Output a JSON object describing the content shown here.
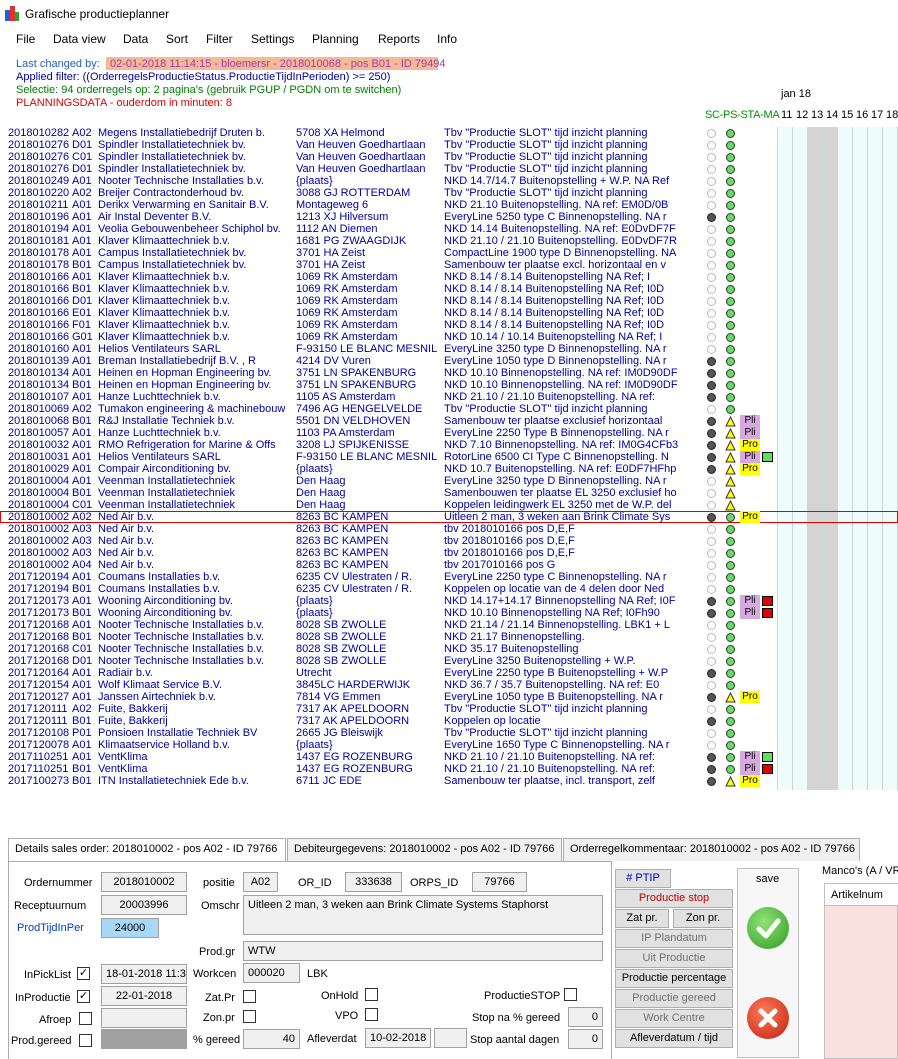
{
  "window": {
    "title": "Grafische productieplanner"
  },
  "menu": [
    "File",
    "Data view",
    "Data",
    "Sort",
    "Filter",
    "Settings",
    "Planning",
    "Reports",
    "Info"
  ],
  "header": {
    "last_changed_label": "Last changed by:",
    "last_changed_value": "02-01-2018 11:14:15 - bloemersr - 2018010068 - pos B01 - ID 79494",
    "applied_filter": "Applied filter: ((OrderregelsProductieStatus.ProductieTijdInPerioden) >= 250)",
    "selection": "Selectie: 94 orderregels op: 2 pagina's (gebruik PGUP / PGDN om te switchen)",
    "planningsdata": "PLANNINGSDATA - ouderdom in minuten: 8"
  },
  "calendar": {
    "month": "jan 18",
    "status_cols": "SC-PS-STA-MA",
    "days": [
      "11",
      "12",
      "13",
      "14",
      "15",
      "16",
      "17",
      "18"
    ]
  },
  "colors": {
    "dark_dot": "#555555",
    "empty_dot": "#ffffff",
    "green": "#5ee05e",
    "yellow": "#ffff00",
    "pli": "#d8a8e0",
    "pro": "#ffff00",
    "red": "#e00000"
  },
  "rows": [
    {
      "order": "2018010282",
      "pos": "A02",
      "name": "Megens Installatiebedrijf Druten b.",
      "city": "5708 XA Helmond",
      "desc": "Tbv \"Productie SLOT\" tijd inzicht planning",
      "s1": "empty",
      "s2": "green",
      "tag": "",
      "tag_color": "",
      "sq": ""
    },
    {
      "order": "2018010276",
      "pos": "D01",
      "name": "Spindler Installatietechniek bv.",
      "city": "Van Heuven Goedhartlaan",
      "desc": "Tbv \"Productie SLOT\" tijd inzicht planning",
      "s1": "empty",
      "s2": "green",
      "tag": "",
      "tag_color": "",
      "sq": ""
    },
    {
      "order": "2018010276",
      "pos": "C01",
      "name": "Spindler Installatietechniek bv.",
      "city": "Van Heuven Goedhartlaan",
      "desc": "Tbv \"Productie SLOT\" tijd inzicht planning",
      "s1": "empty",
      "s2": "green",
      "tag": "",
      "tag_color": "",
      "sq": ""
    },
    {
      "order": "2018010276",
      "pos": "D01",
      "name": "Spindler Installatietechniek bv.",
      "city": "Van Heuven Goedhartlaan",
      "desc": "Tbv \"Productie SLOT\" tijd inzicht planning",
      "s1": "empty",
      "s2": "green",
      "tag": "",
      "tag_color": "",
      "sq": ""
    },
    {
      "order": "2018010249",
      "pos": "A01",
      "name": "Nooter Technische Installaties b.v.",
      "city": "{plaats}",
      "desc": "NKD 14.7/14.7 Buitenopstelling + W.P. NA Ref",
      "s1": "empty",
      "s2": "green",
      "tag": "",
      "tag_color": "",
      "sq": ""
    },
    {
      "order": "2018010220",
      "pos": "A02",
      "name": "Breijer Contractonderhoud bv.",
      "city": "3088 GJ ROTTERDAM",
      "desc": "Tbv \"Productie SLOT\" tijd inzicht planning",
      "s1": "empty",
      "s2": "green",
      "tag": "",
      "tag_color": "",
      "sq": ""
    },
    {
      "order": "2018010211",
      "pos": "A01",
      "name": "Derikx Verwarming en Sanitair B.V.",
      "city": "Montageweg 6",
      "desc": "NKD 21.10 Buitenopstelling. NA ref: EM0D/0B",
      "s1": "empty",
      "s2": "green",
      "tag": "",
      "tag_color": "",
      "sq": ""
    },
    {
      "order": "2018010196",
      "pos": "A01",
      "name": "Air Instal Deventer B.V.",
      "city": "1213 XJ Hilversum",
      "desc": "EveryLine 5250 type C Binnenopstelling. NA r",
      "s1": "dark",
      "s2": "green",
      "tag": "",
      "tag_color": "",
      "sq": ""
    },
    {
      "order": "2018010194",
      "pos": "A01",
      "name": "Veolia Gebouwenbeheer Schiphol bv.",
      "city": "1112 AN Diemen",
      "desc": "NKD 14.14 Buitenopstelling. NA ref: E0DvDF7F",
      "s1": "empty",
      "s2": "green",
      "tag": "",
      "tag_color": "",
      "sq": ""
    },
    {
      "order": "2018010181",
      "pos": "A01",
      "name": "Klaver Klimaattechniek b.v.",
      "city": "1681 PG ZWAAGDIJK",
      "desc": "NKD 21.10 / 21.10 Buitenopstelling. E0DvDF7R",
      "s1": "empty",
      "s2": "green",
      "tag": "",
      "tag_color": "",
      "sq": ""
    },
    {
      "order": "2018010178",
      "pos": "A01",
      "name": "Campus Installatietechniek bv.",
      "city": "3701 HA Zeist",
      "desc": "CompactLine 1900 type D Binnenopstelling. NA",
      "s1": "empty",
      "s2": "green",
      "tag": "",
      "tag_color": "",
      "sq": ""
    },
    {
      "order": "2018010178",
      "pos": "B01",
      "name": "Campus Installatietechniek bv.",
      "city": "3701 HA Zeist",
      "desc": "Samenbouw ter plaatse excl. horizontaal en v",
      "s1": "empty",
      "s2": "green",
      "tag": "",
      "tag_color": "",
      "sq": ""
    },
    {
      "order": "2018010166",
      "pos": "A01",
      "name": "Klaver Klimaattechniek b.v.",
      "city": "1069 RK Amsterdam",
      "desc": "NKD 8.14 / 8.14 Buitenopstelling NA Ref; I",
      "s1": "empty",
      "s2": "green",
      "tag": "",
      "tag_color": "",
      "sq": ""
    },
    {
      "order": "2018010166",
      "pos": "B01",
      "name": "Klaver Klimaattechniek b.v.",
      "city": "1069 RK Amsterdam",
      "desc": "NKD 8.14 / 8.14 Buitenopstelling NA Ref; I0D",
      "s1": "empty",
      "s2": "green",
      "tag": "",
      "tag_color": "",
      "sq": ""
    },
    {
      "order": "2018010166",
      "pos": "D01",
      "name": "Klaver Klimaattechniek b.v.",
      "city": "1069 RK Amsterdam",
      "desc": "NKD 8.14 / 8.14 Buitenopstelling NA Ref; I0D",
      "s1": "empty",
      "s2": "green",
      "tag": "",
      "tag_color": "",
      "sq": ""
    },
    {
      "order": "2018010166",
      "pos": "E01",
      "name": "Klaver Klimaattechniek b.v.",
      "city": "1069 RK Amsterdam",
      "desc": "NKD 8.14 / 8.14 Buitenopstelling NA Ref; I0D",
      "s1": "empty",
      "s2": "green",
      "tag": "",
      "tag_color": "",
      "sq": ""
    },
    {
      "order": "2018010166",
      "pos": "F01",
      "name": "Klaver Klimaattechniek b.v.",
      "city": "1069 RK Amsterdam",
      "desc": "NKD 8.14 / 8.14 Buitenopstelling NA Ref; I0D",
      "s1": "empty",
      "s2": "green",
      "tag": "",
      "tag_color": "",
      "sq": ""
    },
    {
      "order": "2018010166",
      "pos": "G01",
      "name": "Klaver Klimaattechniek b.v.",
      "city": "1069 RK Amsterdam",
      "desc": "NKD 10.14 / 10.14 Buitenopstelling NA Ref; I",
      "s1": "empty",
      "s2": "green",
      "tag": "",
      "tag_color": "",
      "sq": ""
    },
    {
      "order": "2018010160",
      "pos": "A01",
      "name": "Helios Ventilateurs SARL",
      "city": "F-93150 LE BLANC MESNIL",
      "desc": "EveryLine 3250 type D Binnenopstelling. NA r",
      "s1": "empty",
      "s2": "green",
      "tag": "",
      "tag_color": "",
      "sq": ""
    },
    {
      "order": "2018010139",
      "pos": "A01",
      "name": "Breman Installatiebedrijf B.V. , R",
      "city": "4214 DV Vuren",
      "desc": "EveryLine 1050 type D Binnenopstelling. NA r",
      "s1": "dark",
      "s2": "green",
      "tag": "",
      "tag_color": "",
      "sq": ""
    },
    {
      "order": "2018010134",
      "pos": "A01",
      "name": "Heinen en Hopman Engineering bv.",
      "city": "3751 LN SPAKENBURG",
      "desc": "NKD 10.10 Binnenopstelling. NA ref: IM0D90DF",
      "s1": "dark",
      "s2": "green",
      "tag": "",
      "tag_color": "",
      "sq": ""
    },
    {
      "order": "2018010134",
      "pos": "B01",
      "name": "Heinen en Hopman Engineering bv.",
      "city": "3751 LN SPAKENBURG",
      "desc": "NKD 10.10 Binnenopstelling. NA ref: IM0D90DF",
      "s1": "dark",
      "s2": "green",
      "tag": "",
      "tag_color": "",
      "sq": ""
    },
    {
      "order": "2018010107",
      "pos": "A01",
      "name": "Hanze Luchttechniek b.v.",
      "city": "1105 AS Amsterdam",
      "desc": "NKD 21.10 / 21.10 Buitenopstelling. NA ref:",
      "s1": "dark",
      "s2": "green",
      "tag": "",
      "tag_color": "",
      "sq": ""
    },
    {
      "order": "2018010069",
      "pos": "A02",
      "name": "Tumakon engineering & machinebouw",
      "city": "7496 AG HENGELVELDE",
      "desc": "Tbv \"Productie SLOT\" tijd inzicht planning",
      "s1": "empty",
      "s2": "green",
      "tag": "",
      "tag_color": "",
      "sq": ""
    },
    {
      "order": "2018010068",
      "pos": "B01",
      "name": "R&J Installatie Techniek b.v.",
      "city": "5501 DN VELDHOVEN",
      "desc": "Samenbouw ter plaatse exclusief horizontaal",
      "s1": "dark",
      "s2": "yellow",
      "tag": "Pli",
      "tag_color": "pli",
      "sq": ""
    },
    {
      "order": "2018010057",
      "pos": "A01",
      "name": "Hanze Luchttechniek b.v.",
      "city": "1103 PA Amsterdam",
      "desc": "EveryLine 2250 Type B Binnenopstelling. NA r",
      "s1": "dark",
      "s2": "yellow",
      "tag": "Pli",
      "tag_color": "pli",
      "sq": ""
    },
    {
      "order": "2018010032",
      "pos": "A01",
      "name": "RMO Refrigeration for Marine & Offs",
      "city": "3208 LJ SPIJKENISSE",
      "desc": "NKD 7.10 Binnenopstelling. NA ref: IM0G4CFb3",
      "s1": "dark",
      "s2": "yellow",
      "tag": "Pro",
      "tag_color": "pro",
      "sq": ""
    },
    {
      "order": "2018010031",
      "pos": "A01",
      "name": "Helios Ventilateurs SARL",
      "city": "F-93150 LE BLANC MESNIL",
      "desc": "RotorLine 6500 CI Type C Binnenopstelling. N",
      "s1": "dark",
      "s2": "yellow",
      "tag": "Pli",
      "tag_color": "pli",
      "sq": "green"
    },
    {
      "order": "2018010029",
      "pos": "A01",
      "name": "Compair Airconditioning bv.",
      "city": "{plaats}",
      "desc": "NKD 10.7 Buitenopstelling. NA ref: E0DF7HFhp",
      "s1": "dark",
      "s2": "yellow",
      "tag": "Pro",
      "tag_color": "pro",
      "sq": ""
    },
    {
      "order": "2018010004",
      "pos": "A01",
      "name": "Veenman Installatietechniek",
      "city": "Den Haag",
      "desc": "EveryLine 3250 type D Binnenopstelling. NA r",
      "s1": "empty",
      "s2": "yellow",
      "tag": "",
      "tag_color": "",
      "sq": ""
    },
    {
      "order": "2018010004",
      "pos": "B01",
      "name": "Veenman Installatietechniek",
      "city": "Den Haag",
      "desc": "Samenbouwen ter plaatse EL 3250 exclusief ho",
      "s1": "empty",
      "s2": "yellow",
      "tag": "",
      "tag_color": "",
      "sq": ""
    },
    {
      "order": "2018010004",
      "pos": "C01",
      "name": "Veenman Installatietechniek",
      "city": "Den Haag",
      "desc": "Koppelen leidingwerk EL 3250 met de W.P. del",
      "s1": "empty",
      "s2": "yellow",
      "tag": "",
      "tag_color": "",
      "sq": ""
    },
    {
      "order": "2018010002",
      "pos": "A02",
      "name": "Ned Air b.v.",
      "city": "8263 BC KAMPEN",
      "desc": "Uitleen 2 man, 3 weken aan Brink Climate Sys",
      "s1": "dark",
      "s2": "green",
      "tag": "Pro",
      "tag_color": "pro",
      "sq": "",
      "selected": true
    },
    {
      "order": "2018010002",
      "pos": "A03",
      "name": "Ned Air b.v.",
      "city": "8263 BC KAMPEN",
      "desc": "tbv 2018010166 pos D,E,F",
      "s1": "empty",
      "s2": "green",
      "tag": "",
      "tag_color": "",
      "sq": ""
    },
    {
      "order": "2018010002",
      "pos": "A03",
      "name": "Ned Air b.v.",
      "city": "8263 BC KAMPEN",
      "desc": "tbv 2018010166 pos D,E,F",
      "s1": "empty",
      "s2": "green",
      "tag": "",
      "tag_color": "",
      "sq": ""
    },
    {
      "order": "2018010002",
      "pos": "A03",
      "name": "Ned Air b.v.",
      "city": "8263 BC KAMPEN",
      "desc": "tbv 2018010166 pos D,E,F",
      "s1": "empty",
      "s2": "green",
      "tag": "",
      "tag_color": "",
      "sq": ""
    },
    {
      "order": "2018010002",
      "pos": "A04",
      "name": "Ned Air b.v.",
      "city": "8263 BC KAMPEN",
      "desc": "tbv 2017010166 pos G",
      "s1": "empty",
      "s2": "green",
      "tag": "",
      "tag_color": "",
      "sq": ""
    },
    {
      "order": "2017120194",
      "pos": "A01",
      "name": "Coumans Installaties b.v.",
      "city": "6235 CV Ulestraten / R.",
      "desc": "EveryLine 2250 type C Binnenopstelling. NA r",
      "s1": "empty",
      "s2": "green",
      "tag": "",
      "tag_color": "",
      "sq": ""
    },
    {
      "order": "2017120194",
      "pos": "B01",
      "name": "Coumans Installaties b.v.",
      "city": "6235 CV Ulestraten / R.",
      "desc": "Koppelen op locatie van de 4 delen door Ned",
      "s1": "empty",
      "s2": "green",
      "tag": "",
      "tag_color": "",
      "sq": ""
    },
    {
      "order": "2017120173",
      "pos": "A01",
      "name": "Wooning Airconditioning bv.",
      "city": "{plaats}",
      "desc": "NKD 14.17+14.17 Binnenopstelling NA Ref; I0F",
      "s1": "dark",
      "s2": "green",
      "tag": "Pli",
      "tag_color": "pli",
      "sq": "red"
    },
    {
      "order": "2017120173",
      "pos": "B01",
      "name": "Wooning Airconditioning bv.",
      "city": "{plaats}",
      "desc": "NKD 10.10 Binnenopstelling NA Ref; I0Fh90",
      "s1": "dark",
      "s2": "green",
      "tag": "Pli",
      "tag_color": "pli",
      "sq": "red"
    },
    {
      "order": "2017120168",
      "pos": "A01",
      "name": "Nooter Technische Installaties b.v.",
      "city": "8028 SB ZWOLLE",
      "desc": "NKD 21.14 / 21.14 Binnenopstelling. LBK1 + L",
      "s1": "empty",
      "s2": "green",
      "tag": "",
      "tag_color": "",
      "sq": ""
    },
    {
      "order": "2017120168",
      "pos": "B01",
      "name": "Nooter Technische Installaties b.v.",
      "city": "8028 SB ZWOLLE",
      "desc": "NKD 21.17 Binnenopstelling.",
      "s1": "empty",
      "s2": "green",
      "tag": "",
      "tag_color": "",
      "sq": ""
    },
    {
      "order": "2017120168",
      "pos": "C01",
      "name": "Nooter Technische Installaties b.v.",
      "city": "8028 SB ZWOLLE",
      "desc": "NKD 35.17 Buitenopstelling",
      "s1": "empty",
      "s2": "green",
      "tag": "",
      "tag_color": "",
      "sq": ""
    },
    {
      "order": "2017120168",
      "pos": "D01",
      "name": "Nooter Technische Installaties b.v.",
      "city": "8028 SB ZWOLLE",
      "desc": "EveryLine 3250 Buitenopstelling + W.P.",
      "s1": "empty",
      "s2": "green",
      "tag": "",
      "tag_color": "",
      "sq": ""
    },
    {
      "order": "2017120164",
      "pos": "A01",
      "name": "Radiair b.v.",
      "city": "Utrecht",
      "desc": "EveryLine 2250 type B Buitenopstelling + W.P",
      "s1": "dark",
      "s2": "green",
      "tag": "",
      "tag_color": "",
      "sq": ""
    },
    {
      "order": "2017120154",
      "pos": "A01",
      "name": "Wolf Klimaat Service B.V.",
      "city": "3845LC HARDERWIJK",
      "desc": "NKD 36.7 / 35.7 Buitenopstelling. NA ref: E0",
      "s1": "empty",
      "s2": "green",
      "tag": "",
      "tag_color": "",
      "sq": ""
    },
    {
      "order": "2017120127",
      "pos": "A01",
      "name": "Janssen Airtechniek b.v.",
      "city": "7814 VG Emmen",
      "desc": "EveryLine 1050 type B Buitenopstelling. NA r",
      "s1": "dark",
      "s2": "yellow",
      "tag": "Pro",
      "tag_color": "pro",
      "sq": ""
    },
    {
      "order": "2017120111",
      "pos": "A02",
      "name": "Fuite, Bakkerij",
      "city": "7317 AK APELDOORN",
      "desc": "Tbv \"Productie SLOT\" tijd inzicht planning",
      "s1": "empty",
      "s2": "green",
      "tag": "",
      "tag_color": "",
      "sq": ""
    },
    {
      "order": "2017120111",
      "pos": "B01",
      "name": "Fuite, Bakkerij",
      "city": "7317 AK APELDOORN",
      "desc": "Koppelen op locatie",
      "s1": "dark",
      "s2": "green",
      "tag": "",
      "tag_color": "",
      "sq": ""
    },
    {
      "order": "2017120108",
      "pos": "P01",
      "name": "Ponsioen Installatie Techniek BV",
      "city": "2665 JG Bleiswijk",
      "desc": "Tbv \"Productie SLOT\" tijd inzicht planning",
      "s1": "empty",
      "s2": "green",
      "tag": "",
      "tag_color": "",
      "sq": ""
    },
    {
      "order": "2017120078",
      "pos": "A01",
      "name": "Klimaatservice Holland b.v.",
      "city": "{plaats}",
      "desc": "EveryLine 1650 Type C Binnenopstelling. NA r",
      "s1": "empty",
      "s2": "green",
      "tag": "",
      "tag_color": "",
      "sq": ""
    },
    {
      "order": "2017110251",
      "pos": "A01",
      "name": "VentKlima",
      "city": "1437 EG  ROZENBURG",
      "desc": "NKD 21.10 / 21.10 Buitenopstelling. NA ref:",
      "s1": "dark",
      "s2": "green",
      "tag": "Pli",
      "tag_color": "pli",
      "sq": "green"
    },
    {
      "order": "2017110251",
      "pos": "B01",
      "name": "VentKlima",
      "city": "1437 EG  ROZENBURG",
      "desc": "NKD 21.10 / 21.10 Buitenopstelling. NA ref:",
      "s1": "dark",
      "s2": "green",
      "tag": "Pli",
      "tag_color": "pli",
      "sq": "red"
    },
    {
      "order": "2017100273",
      "pos": "B01",
      "name": "ITN Installatietechniek Ede b.v.",
      "city": "6711 JC  EDE",
      "desc": "Samenbouw ter plaatse, incl. transport, zelf",
      "s1": "dark",
      "s2": "yellow",
      "tag": "Pro",
      "tag_color": "pro",
      "sq": ""
    }
  ],
  "tabs": [
    "Details sales order: 2018010002 - pos A02 - ID 79766",
    "Debiteurgegevens: 2018010002 - pos A02 - ID 79766",
    "Orderregelkommentaar: 2018010002 - pos A02 - ID 79766"
  ],
  "details": {
    "ordernummer_label": "Ordernummer",
    "ordernummer": "2018010002",
    "positie_label": "positie",
    "positie": "A02",
    "or_id_label": "OR_ID",
    "or_id": "333638",
    "orps_id_label": "ORPS_ID",
    "orps_id": "79766",
    "receptuurnum_label": "Receptuurnum",
    "receptuurnum": "20003996",
    "omschr_label": "Omschr",
    "omschr": "Uitleen 2 man, 3 weken aan Brink Climate Systems Staphorst",
    "prodtijd_label": "ProdTijdInPer",
    "prodtijd": "24000",
    "prodgr_label": "Prod.gr",
    "prodgr": "WTW",
    "inpicklist_label": "InPickList",
    "inpicklist_date": "18-01-2018 11:3",
    "workcen_label": "Workcen",
    "workcen": "000020",
    "workcen_name": "LBK",
    "inproductie_label": "InProductie",
    "inproductie_date": "22-01-2018",
    "zatpr_label": "Zat.Pr",
    "onhold_label": "OnHold",
    "productiestop_label": "ProductieSTOP",
    "afroep_label": "Afroep",
    "zonpr_label": "Zon.pr",
    "vpo_label": "VPO",
    "stopna_label": "Stop na % gereed",
    "stopna": "0",
    "prodgereed_label": "Prod.gereed",
    "gereed_label": "% gereed",
    "gereed": "40",
    "afleverdat_label": "Afleverdat",
    "afleverdat": "10-02-2018",
    "stopaantal_label": "Stop aantal dagen",
    "stopaantal": "0"
  },
  "buttons": {
    "ptip": "# PTIP",
    "productie_stop": "Productie stop",
    "zat_pr": "Zat pr.",
    "zon_pr": "Zon pr.",
    "ip_plandatum": "IP Plandatum",
    "uit_productie": "Uit Productie",
    "productie_percentage": "Productie percentage",
    "productie_gereed": "Productie gereed",
    "work_centre": "Work Centre",
    "afleverdatum": "Afleverdatum / tijd",
    "save": "save"
  },
  "manco": {
    "title": "Manco's (A / VR",
    "col": "Artikelnum"
  }
}
